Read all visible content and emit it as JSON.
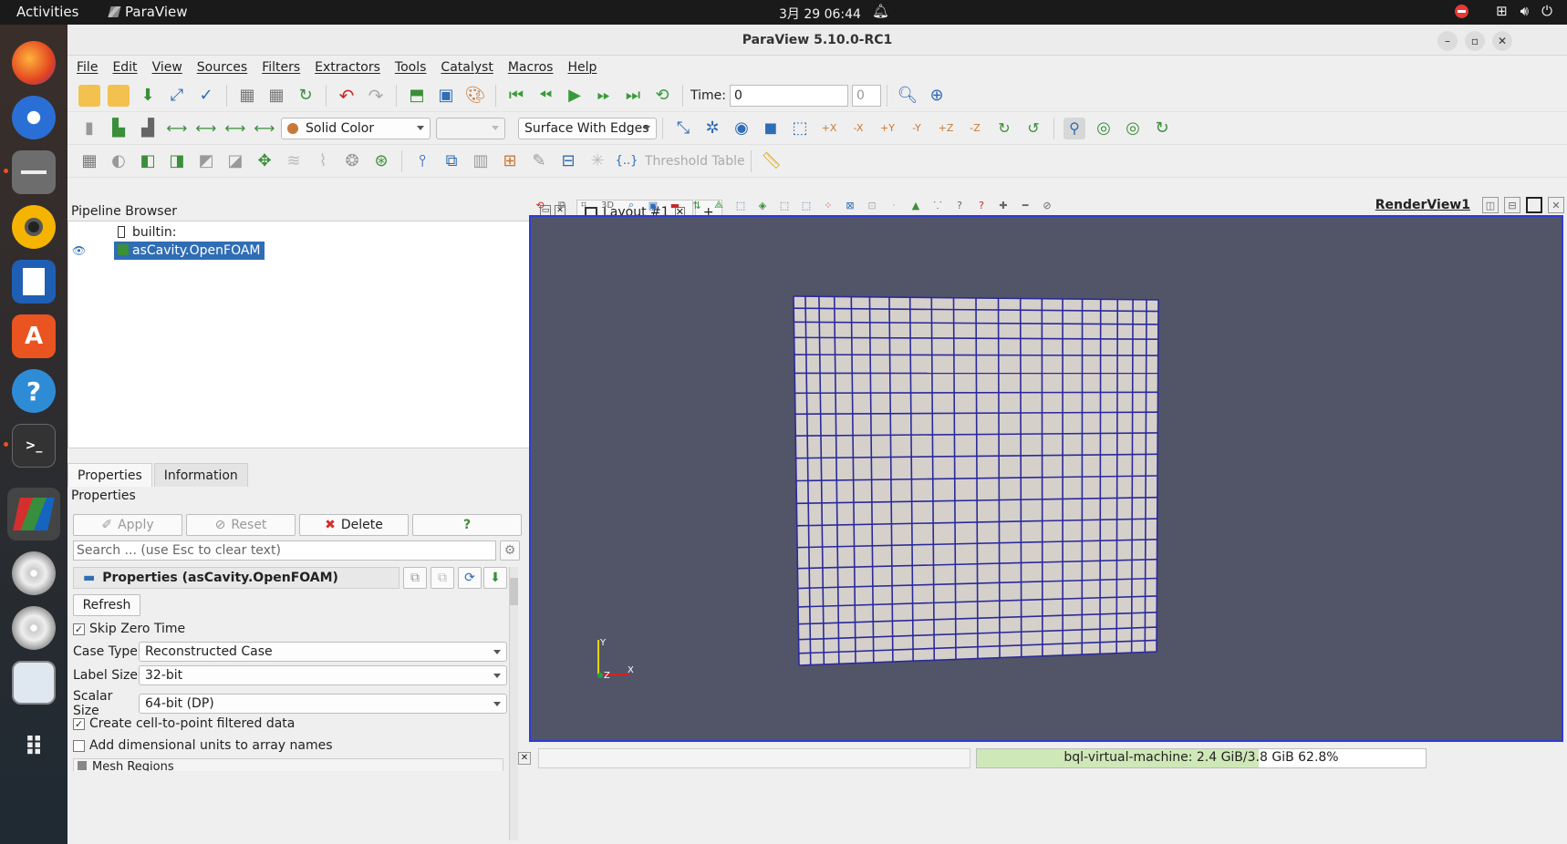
{
  "system": {
    "activities": "Activities",
    "app_name": "ParaView",
    "clock": "3月 29  06:44"
  },
  "window": {
    "title": "ParaView 5.10.0-RC1"
  },
  "menus": [
    "File",
    "Edit",
    "View",
    "Sources",
    "Filters",
    "Extractors",
    "Tools",
    "Catalyst",
    "Macros",
    "Help"
  ],
  "toolbar1": {
    "time_label": "Time:",
    "time_value": "0",
    "timestep_value": "0"
  },
  "toolbar2": {
    "coloring": "Solid Color",
    "representation": "Surface With Edges"
  },
  "toolbar3": {
    "threshold_table": "Threshold Table"
  },
  "pipeline": {
    "title": "Pipeline Browser",
    "items": [
      "builtin:",
      "asCavity.OpenFOAM"
    ]
  },
  "panel_tabs": [
    "Properties",
    "Information"
  ],
  "properties": {
    "title": "Properties",
    "apply": "Apply",
    "reset": "Reset",
    "delete": "Delete",
    "help": "?",
    "search_placeholder": "Search ... (use Esc to clear text)",
    "section_title": "Properties (asCavity.OpenFOAM)",
    "refresh": "Refresh",
    "skip_zero_time": "Skip Zero Time",
    "case_type_label": "Case Type",
    "case_type_value": "Reconstructed Case",
    "label_size_label": "Label Size",
    "label_size_value": "32-bit",
    "scalar_size_label": "Scalar Size",
    "scalar_size_value": "64-bit (DP)",
    "create_cell_to_point": "Create cell-to-point filtered data",
    "add_dimensional_units": "Add dimensional units to array names",
    "mesh_regions": "Mesh Regions"
  },
  "layout": {
    "tab_label": "Layout #1",
    "add_tab": "+",
    "view_button_3d": "3D",
    "render_view_name": "RenderView1",
    "axes": {
      "y": "Y",
      "z": "Z",
      "x": "X"
    },
    "mesh": {
      "columns": 20,
      "rows": 20
    }
  },
  "status": {
    "memory_text": "bql-virtual-machine: 2.4 GiB/3.8 GiB 62.8%",
    "memory_fraction": 0.628
  },
  "colors": {
    "render_background": "#525468",
    "mesh_fill": "#d6d0cb",
    "mesh_edges": "#2a2a9a",
    "selection": "#2f6db5"
  }
}
